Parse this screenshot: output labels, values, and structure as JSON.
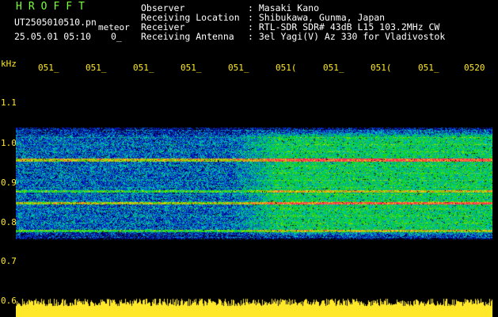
{
  "header": {
    "brand": "HROFFT",
    "filename": "UT2505010510.pn",
    "tag": "meteor",
    "datetime": "25.05.01 05:10",
    "count": "0_"
  },
  "info": [
    {
      "label": "Observer",
      "value": ": Masaki Kano"
    },
    {
      "label": "Receiving Location",
      "value": ": Shibukawa, Gunma, Japan"
    },
    {
      "label": "Receiver",
      "value": ": RTL-SDR SDR# 43dB L15 103.2MHz CW"
    },
    {
      "label": "Receiving Antenna",
      "value": ": 3el Yagi(V) Az 330 for Vladivostok"
    }
  ],
  "axes": {
    "y_unit": "kHz",
    "y_ticks": [
      "1.1",
      "1.0",
      "0.9",
      "0.8",
      "0.7",
      "0.6"
    ],
    "x_ticks": [
      "051_",
      "051_",
      "051_",
      "051_",
      "051_",
      "051(",
      "051_",
      "051(",
      "051_",
      "0520"
    ]
  },
  "colors": {
    "text": "#ffffff",
    "brand": "#7cff3c",
    "axis": "#ffe82a",
    "background": "#000000"
  },
  "spectrogram": {
    "hot_bands_khz": [
      0.96,
      0.85,
      0.88,
      0.78
    ],
    "noise_band_khz": [
      0.76,
      1.04
    ],
    "activity_start_fraction": 0.45
  }
}
